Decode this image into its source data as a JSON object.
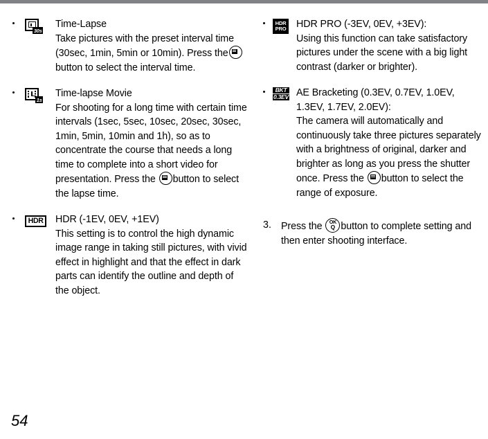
{
  "page": {
    "number": "54",
    "top_rule_color": "#808285"
  },
  "left_column": {
    "items": [
      {
        "icon_name": "time-lapse-mode-icon",
        "icon_tag": "30s",
        "title": "Time-Lapse",
        "body_before": "Take pictures with the preset interval time (30sec, 1min, 5min or 10min). Press the",
        "inline_button": "menu-button-icon",
        "body_after": "button to select the interval time."
      },
      {
        "icon_name": "time-lapse-movie-mode-icon",
        "icon_tag": "1s",
        "title": "Time-lapse Movie",
        "body_before": "For shooting for a long time with certain time intervals (1sec, 5sec, 10sec, 20sec, 30sec, 1min, 5min, 10min and 1h), so as to concentrate the course that needs a long time to complete into a short video for presentation. Press the",
        "inline_button": "menu-button-icon",
        "body_after": "button to select the lapse time."
      },
      {
        "icon_name": "hdr-mode-icon",
        "icon_label": "HDR",
        "title": "HDR (-1EV, 0EV, +1EV)",
        "body_before": "This setting is to control the high dynamic image range in taking still pictures, with vivid effect in highlight and that the effect in dark parts can identify the outline and depth of the object.",
        "inline_button": null,
        "body_after": ""
      }
    ]
  },
  "right_column": {
    "items": [
      {
        "icon_name": "hdr-pro-mode-icon",
        "icon_line1": "HDR",
        "icon_line2": "PRO",
        "title": "HDR PRO (-3EV, 0EV, +3EV):",
        "body_before": "Using this function can take satisfactory pictures under the scene with a big light contrast (darker or brighter).",
        "inline_button": null,
        "body_after": ""
      },
      {
        "icon_name": "ae-bracketing-mode-icon",
        "icon_line1": "BKT",
        "icon_line2": "0.3EV",
        "title": "AE Bracketing (0.3EV, 0.7EV, 1.0EV, 1.3EV, 1.7EV, 2.0EV):",
        "body_before": "The camera will automatically and continuously take three pictures separately with a brightness of original, darker and brighter as long as you press the shutter once. Press the",
        "inline_button": "menu-button-icon",
        "body_after": "button to select the range of exposure."
      }
    ],
    "step": {
      "number": "3.",
      "text_before": "Press the",
      "inline_button": "ok-button-icon",
      "text_after": "button to complete setting and then enter shooting interface."
    }
  },
  "glyphs": {
    "ok_top": "OK",
    "ok_bottom": "Q"
  }
}
